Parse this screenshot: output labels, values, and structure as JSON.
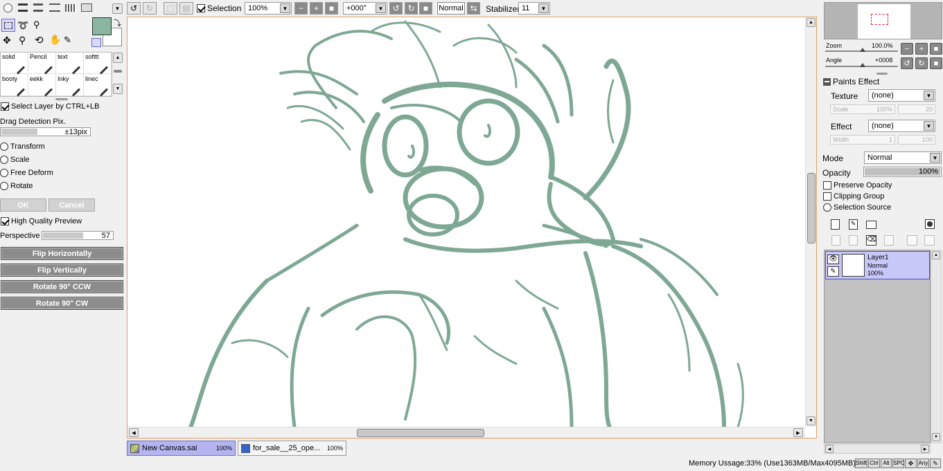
{
  "toolbar": {
    "selection_label": "Selection",
    "zoom_value": "100%",
    "angle_value": "+000°",
    "blend_value": "Normal",
    "stabilizer_label": "Stabilizer",
    "stabilizer_value": "11"
  },
  "colors": {
    "primary": "#8ab5a0",
    "secondary": "#ffffff",
    "sketch": "#7ea894",
    "layer_highlight": "#c8c8f8",
    "tab_active": "#b4b4f0"
  },
  "brushes": [
    {
      "label": "solid"
    },
    {
      "label": "Pencil"
    },
    {
      "label": "text"
    },
    {
      "label": "softtt"
    },
    {
      "label": "booty"
    },
    {
      "label": "eekk"
    },
    {
      "label": "Inky"
    },
    {
      "label": "linec"
    }
  ],
  "left_panel": {
    "select_layer_label": "Select Layer by CTRL+LB",
    "drag_detection_label": "Drag Detection Pix.",
    "drag_detection_value": "±13pix",
    "drag_detection_level": 0.4,
    "transform_options": [
      "Transform",
      "Scale",
      "Free Deform",
      "Rotate"
    ],
    "ok_label": "OK",
    "cancel_label": "Cancel",
    "hq_preview_label": "High Quality Preview",
    "perspective_label": "Perspective",
    "perspective_value": "57",
    "perspective_level": 0.57,
    "flip_h_label": "Flip Horizontally",
    "flip_v_label": "Flip Vertically",
    "rotate_ccw_label": "Rotate 90° CCW",
    "rotate_cw_label": "Rotate 90° CW"
  },
  "navigator": {
    "zoom_label": "Zoom",
    "zoom_value": "100.0%",
    "angle_label": "Angle",
    "angle_value": "+0008"
  },
  "right_panel": {
    "paints_effect_label": "Paints Effect",
    "texture_label": "Texture",
    "texture_value": "(none)",
    "scale_label": "Scale",
    "scale_value": "100%",
    "scale_num": "20",
    "effect_label": "Effect",
    "effect_value": "(none)",
    "width_label": "Width",
    "width_value": "1",
    "width_num": "100",
    "mode_label": "Mode",
    "mode_value": "Normal",
    "opacity_label": "Opacity",
    "opacity_value": "100%",
    "preserve_opacity_label": "Preserve Opacity",
    "clipping_group_label": "Clipping Group",
    "selection_source_label": "Selection Source"
  },
  "layers": [
    {
      "name": "Layer1",
      "mode": "Normal",
      "opacity": "100%"
    }
  ],
  "tabs": [
    {
      "name": "New Canvas.sai",
      "zoom": "100%"
    },
    {
      "name": "for_sale__25_ope...",
      "zoom": "100%"
    }
  ],
  "status": {
    "memory": "Memory Ussage:33% (Use1363MB/Max4095MB)",
    "keys": [
      "Shift",
      "Ctrl",
      "Alt",
      "SPC",
      "Any"
    ]
  }
}
